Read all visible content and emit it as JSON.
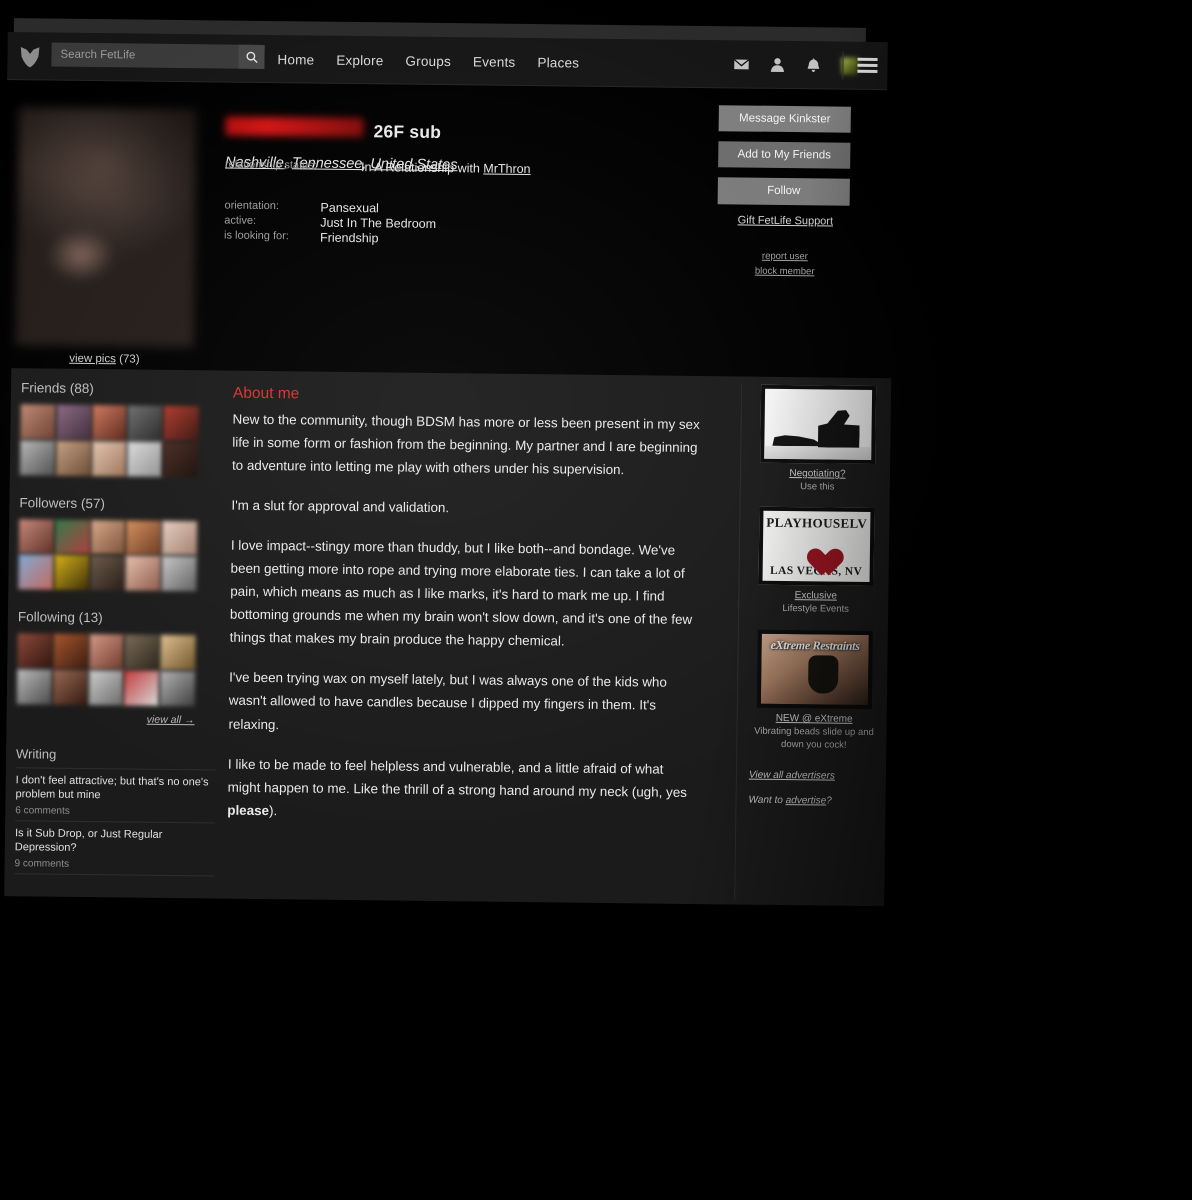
{
  "site": {
    "name": "FetLife",
    "logo_icon": "fetlife-bat-logo"
  },
  "nav": {
    "search_placeholder": "Search FetLife",
    "search_value": "",
    "search_icon": "search-icon",
    "links": [
      {
        "label": "Home"
      },
      {
        "label": "Explore"
      },
      {
        "label": "Groups"
      },
      {
        "label": "Events"
      },
      {
        "label": "Places"
      }
    ],
    "icons": [
      {
        "name": "mail-icon"
      },
      {
        "name": "user-icon"
      },
      {
        "name": "bell-icon"
      }
    ],
    "user": {
      "username": "",
      "avatar": "user-avatar-blurred"
    },
    "menu_icon": "hamburger-menu-icon"
  },
  "profile": {
    "username": "",
    "age_sex_role": "26F sub",
    "avatar": "profile-photo-blurred",
    "view_pics_label": "view pics",
    "pics_count": "(73)",
    "location": {
      "city": "Nashville",
      "state": "Tennessee",
      "country": "United States",
      "sep": ","
    },
    "details": [
      {
        "key": "relationship status:",
        "value": "In A Relationship with ",
        "link": "MrThron"
      },
      {
        "key": "orientation:",
        "value": "Pansexual"
      },
      {
        "key": "active:",
        "value": "Just In The Bedroom"
      },
      {
        "key": "is looking for:",
        "value": "Friendship"
      }
    ]
  },
  "actions": {
    "message_label": "Message Kinkster",
    "friend_label": "Add to My Friends",
    "follow_label": "Follow",
    "gift_label": "Gift FetLife Support",
    "report_label": "report user",
    "block_label": "block member"
  },
  "connections": [
    {
      "title": "Friends (88)"
    },
    {
      "title": "Followers (57)"
    },
    {
      "title": "Following (13)"
    }
  ],
  "view_all_label": "view all →",
  "writing": {
    "title": "Writing",
    "items": [
      {
        "title": "I don't feel attractive; but that's no one's problem but mine",
        "comments": "6 comments"
      },
      {
        "title": "Is it Sub Drop, or Just Regular Depression?",
        "comments": "9 comments"
      }
    ]
  },
  "about": {
    "heading": "About me",
    "paragraphs": [
      "New to the community, though BDSM has more or less been present in my sex life in some form or fashion from the beginning. My partner and I are beginning to adventure into letting me play with others under his supervision.",
      "I'm a slut for approval and validation.",
      "I love impact--stingy more than thuddy, but I like both--and bondage. We've been getting more into rope and trying more elaborate ties. I can take a lot of pain, which means as much as I like marks, it's hard to mark me up. I find bottoming grounds me when my brain won't slow down, and it's one of the few things that makes my brain produce the happy chemical.",
      "I've been trying wax on myself lately, but I was always one of the kids who wasn't allowed to have candles because I dipped my fingers in them. It's relaxing."
    ],
    "final_paragraph_pre": "I like to be made to feel helpless and vulnerable, and a little afraid of what might happen to me. Like the thrill of a strong hand around my neck (ugh, yes ",
    "final_paragraph_bold": "please",
    "final_paragraph_post": ")."
  },
  "ads": [
    {
      "image": "bdsm-silhouette-ad-image",
      "link": "Negotiating?",
      "sub": "Use this"
    },
    {
      "image": "playhouselv-logo-ad-image",
      "brand_top": "PLAYHOUSELV",
      "brand_bottom": "LAS VEGAS, NV",
      "link": "Exclusive",
      "sub": "Lifestyle Events"
    },
    {
      "image": "extreme-restraints-ad-image",
      "brand": "eXtreme Restraints",
      "link": "NEW @ eXtreme",
      "sub": "Vibrating beads slide up and down you cock!"
    }
  ],
  "ads_footer": {
    "view_all": "View all advertisers",
    "want_to_pre": "Want to ",
    "want_to_link": "advertise",
    "want_to_post": "?"
  },
  "colors": {
    "accent_red": "#d6332e",
    "page_bg": "#000000",
    "panel_bg": "#1b1b1b",
    "nav_bg": "#161616"
  }
}
